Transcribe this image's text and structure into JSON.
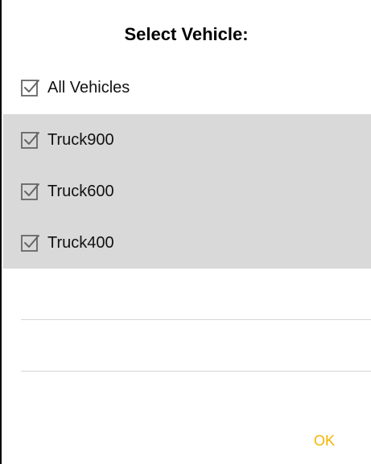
{
  "dialog": {
    "title": "Select Vehicle:",
    "ok_label": "OK"
  },
  "vehicles": [
    {
      "label": "All Vehicles",
      "checked": true,
      "selected": false
    },
    {
      "label": "Truck900",
      "checked": true,
      "selected": true
    },
    {
      "label": "Truck600",
      "checked": true,
      "selected": true
    },
    {
      "label": "Truck400",
      "checked": true,
      "selected": true
    }
  ],
  "colors": {
    "selected_row_bg": "#d9d9d9",
    "ok_text": "#f5b400",
    "checkbox_stroke": "#666666"
  },
  "icons": {
    "checkbox": "checkbox-checked-icon"
  }
}
